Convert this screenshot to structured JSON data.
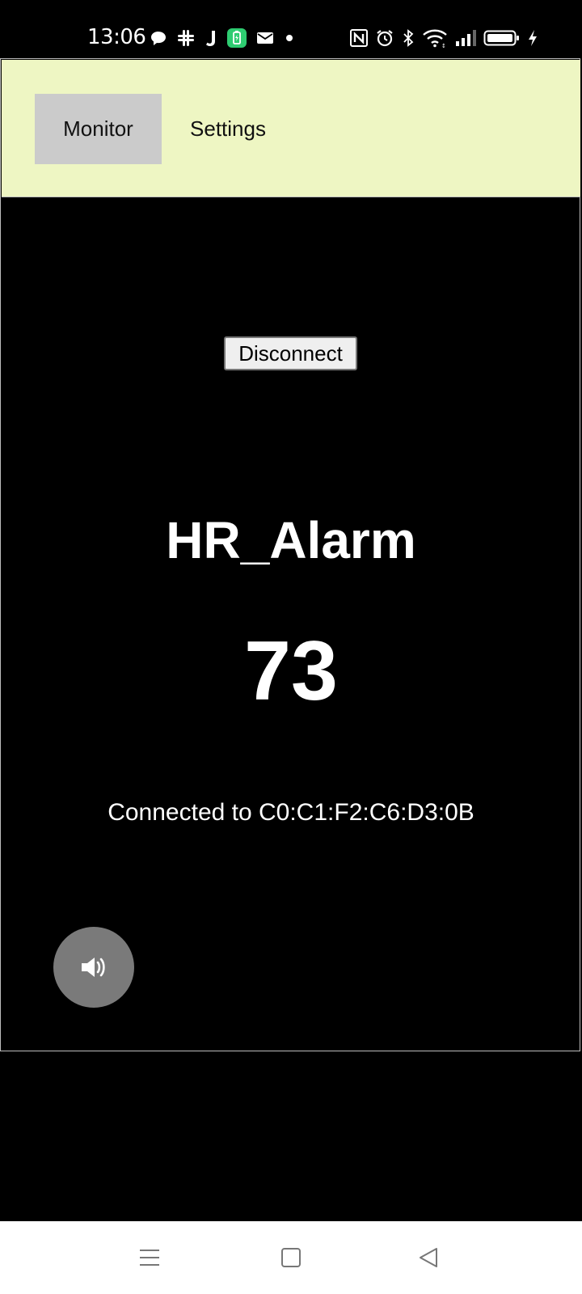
{
  "status_bar": {
    "time": "13:06",
    "left_icons": [
      "chat-bubble-icon",
      "slack-icon",
      "j-app-icon",
      "battery-app-icon",
      "mail-icon",
      "dot-icon"
    ],
    "right_icons": [
      "nfc-icon",
      "alarm-icon",
      "bluetooth-icon",
      "wifi-icon",
      "signal-icon",
      "battery-icon",
      "charging-icon"
    ]
  },
  "nav": {
    "tabs": [
      {
        "label": "Monitor",
        "selected": true
      },
      {
        "label": "Settings",
        "selected": false
      }
    ]
  },
  "monitor": {
    "disconnect_label": "Disconnect",
    "device_name": "HR_Alarm",
    "heart_rate": "73",
    "connection_status": "Connected to C0:C1:F2:C6:D3:0B",
    "sound_icon": "speaker-icon"
  },
  "system_nav": {
    "buttons": [
      "menu-icon",
      "home-icon",
      "back-icon"
    ]
  },
  "colors": {
    "nav_background": "#eef6c3",
    "selected_tab": "#cbcbcb",
    "main_background": "#000000",
    "sound_button": "#7a7a7a"
  }
}
